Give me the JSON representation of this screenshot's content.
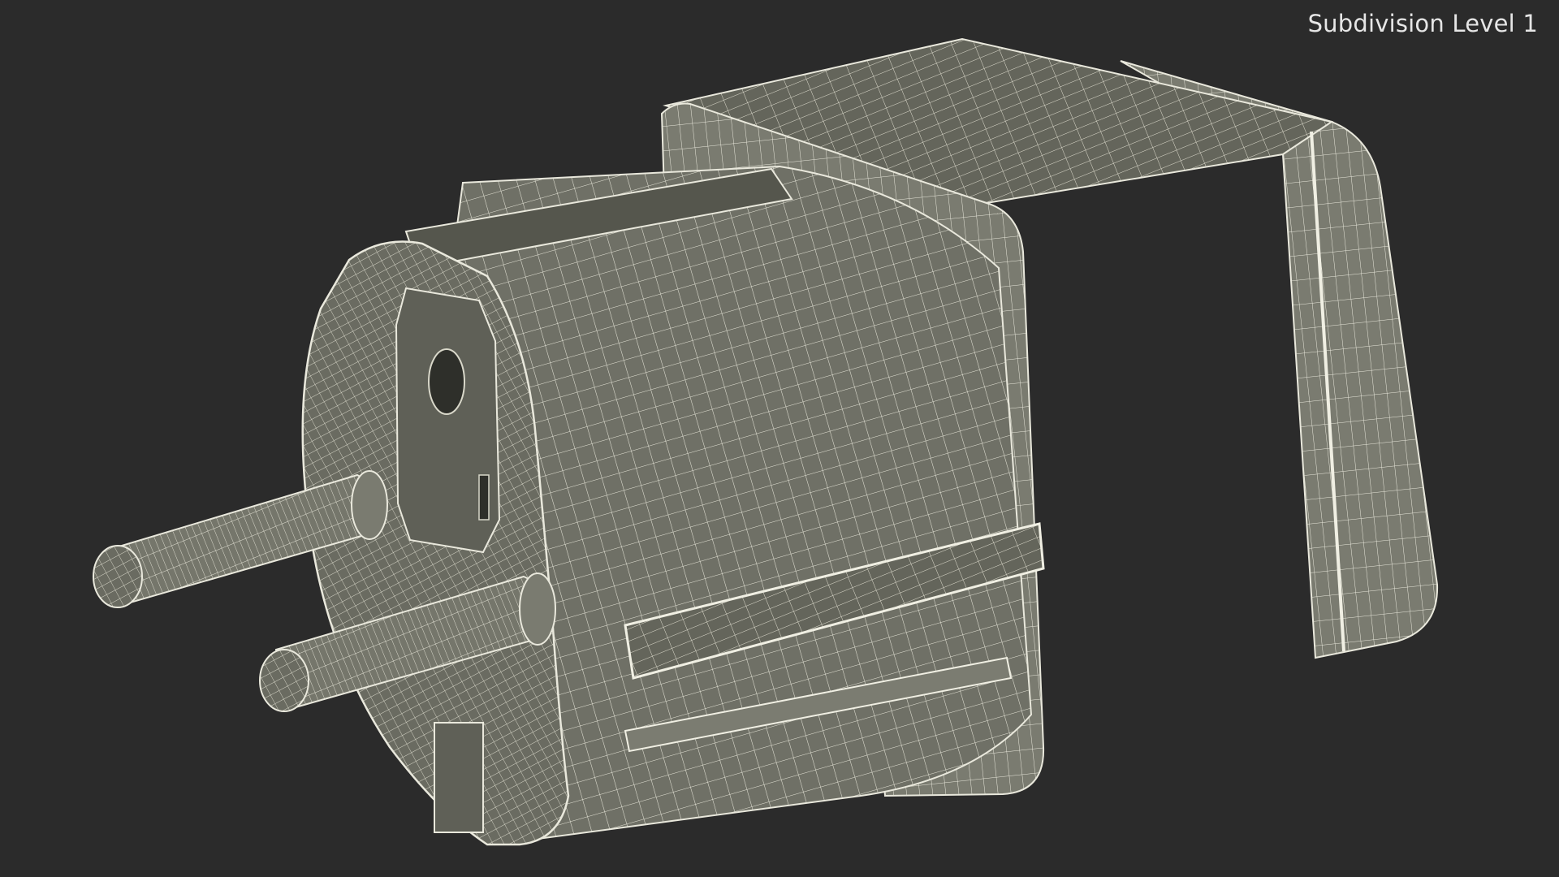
{
  "viewport": {
    "caption": "Subdivision Level 1",
    "background_color": "#2b2b2b",
    "mesh_color": "#6d6e63",
    "wire_color": "#e9e8dc"
  },
  "model": {
    "icon": "wireframe-plug-adapter-render"
  }
}
